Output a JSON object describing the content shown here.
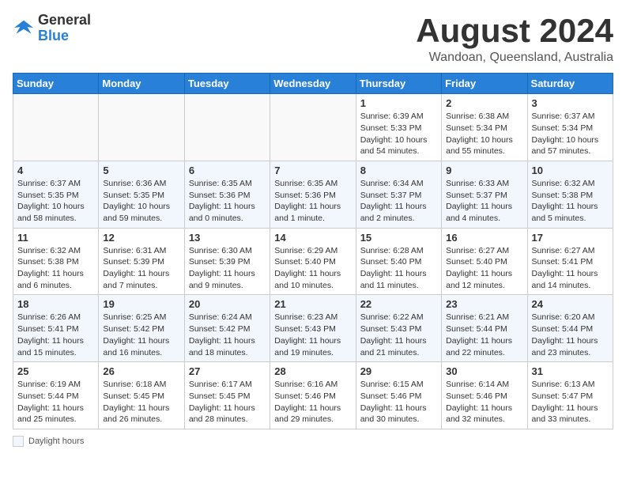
{
  "header": {
    "logo_general": "General",
    "logo_blue": "Blue",
    "month_title": "August 2024",
    "location": "Wandoan, Queensland, Australia"
  },
  "footer": {
    "note_label": "Daylight hours"
  },
  "days_of_week": [
    "Sunday",
    "Monday",
    "Tuesday",
    "Wednesday",
    "Thursday",
    "Friday",
    "Saturday"
  ],
  "weeks": [
    [
      {
        "day": "",
        "info": ""
      },
      {
        "day": "",
        "info": ""
      },
      {
        "day": "",
        "info": ""
      },
      {
        "day": "",
        "info": ""
      },
      {
        "day": "1",
        "info": "Sunrise: 6:39 AM\nSunset: 5:33 PM\nDaylight: 10 hours and 54 minutes."
      },
      {
        "day": "2",
        "info": "Sunrise: 6:38 AM\nSunset: 5:34 PM\nDaylight: 10 hours and 55 minutes."
      },
      {
        "day": "3",
        "info": "Sunrise: 6:37 AM\nSunset: 5:34 PM\nDaylight: 10 hours and 57 minutes."
      }
    ],
    [
      {
        "day": "4",
        "info": "Sunrise: 6:37 AM\nSunset: 5:35 PM\nDaylight: 10 hours and 58 minutes."
      },
      {
        "day": "5",
        "info": "Sunrise: 6:36 AM\nSunset: 5:35 PM\nDaylight: 10 hours and 59 minutes."
      },
      {
        "day": "6",
        "info": "Sunrise: 6:35 AM\nSunset: 5:36 PM\nDaylight: 11 hours and 0 minutes."
      },
      {
        "day": "7",
        "info": "Sunrise: 6:35 AM\nSunset: 5:36 PM\nDaylight: 11 hours and 1 minute."
      },
      {
        "day": "8",
        "info": "Sunrise: 6:34 AM\nSunset: 5:37 PM\nDaylight: 11 hours and 2 minutes."
      },
      {
        "day": "9",
        "info": "Sunrise: 6:33 AM\nSunset: 5:37 PM\nDaylight: 11 hours and 4 minutes."
      },
      {
        "day": "10",
        "info": "Sunrise: 6:32 AM\nSunset: 5:38 PM\nDaylight: 11 hours and 5 minutes."
      }
    ],
    [
      {
        "day": "11",
        "info": "Sunrise: 6:32 AM\nSunset: 5:38 PM\nDaylight: 11 hours and 6 minutes."
      },
      {
        "day": "12",
        "info": "Sunrise: 6:31 AM\nSunset: 5:39 PM\nDaylight: 11 hours and 7 minutes."
      },
      {
        "day": "13",
        "info": "Sunrise: 6:30 AM\nSunset: 5:39 PM\nDaylight: 11 hours and 9 minutes."
      },
      {
        "day": "14",
        "info": "Sunrise: 6:29 AM\nSunset: 5:40 PM\nDaylight: 11 hours and 10 minutes."
      },
      {
        "day": "15",
        "info": "Sunrise: 6:28 AM\nSunset: 5:40 PM\nDaylight: 11 hours and 11 minutes."
      },
      {
        "day": "16",
        "info": "Sunrise: 6:27 AM\nSunset: 5:40 PM\nDaylight: 11 hours and 12 minutes."
      },
      {
        "day": "17",
        "info": "Sunrise: 6:27 AM\nSunset: 5:41 PM\nDaylight: 11 hours and 14 minutes."
      }
    ],
    [
      {
        "day": "18",
        "info": "Sunrise: 6:26 AM\nSunset: 5:41 PM\nDaylight: 11 hours and 15 minutes."
      },
      {
        "day": "19",
        "info": "Sunrise: 6:25 AM\nSunset: 5:42 PM\nDaylight: 11 hours and 16 minutes."
      },
      {
        "day": "20",
        "info": "Sunrise: 6:24 AM\nSunset: 5:42 PM\nDaylight: 11 hours and 18 minutes."
      },
      {
        "day": "21",
        "info": "Sunrise: 6:23 AM\nSunset: 5:43 PM\nDaylight: 11 hours and 19 minutes."
      },
      {
        "day": "22",
        "info": "Sunrise: 6:22 AM\nSunset: 5:43 PM\nDaylight: 11 hours and 21 minutes."
      },
      {
        "day": "23",
        "info": "Sunrise: 6:21 AM\nSunset: 5:44 PM\nDaylight: 11 hours and 22 minutes."
      },
      {
        "day": "24",
        "info": "Sunrise: 6:20 AM\nSunset: 5:44 PM\nDaylight: 11 hours and 23 minutes."
      }
    ],
    [
      {
        "day": "25",
        "info": "Sunrise: 6:19 AM\nSunset: 5:44 PM\nDaylight: 11 hours and 25 minutes."
      },
      {
        "day": "26",
        "info": "Sunrise: 6:18 AM\nSunset: 5:45 PM\nDaylight: 11 hours and 26 minutes."
      },
      {
        "day": "27",
        "info": "Sunrise: 6:17 AM\nSunset: 5:45 PM\nDaylight: 11 hours and 28 minutes."
      },
      {
        "day": "28",
        "info": "Sunrise: 6:16 AM\nSunset: 5:46 PM\nDaylight: 11 hours and 29 minutes."
      },
      {
        "day": "29",
        "info": "Sunrise: 6:15 AM\nSunset: 5:46 PM\nDaylight: 11 hours and 30 minutes."
      },
      {
        "day": "30",
        "info": "Sunrise: 6:14 AM\nSunset: 5:46 PM\nDaylight: 11 hours and 32 minutes."
      },
      {
        "day": "31",
        "info": "Sunrise: 6:13 AM\nSunset: 5:47 PM\nDaylight: 11 hours and 33 minutes."
      }
    ]
  ]
}
